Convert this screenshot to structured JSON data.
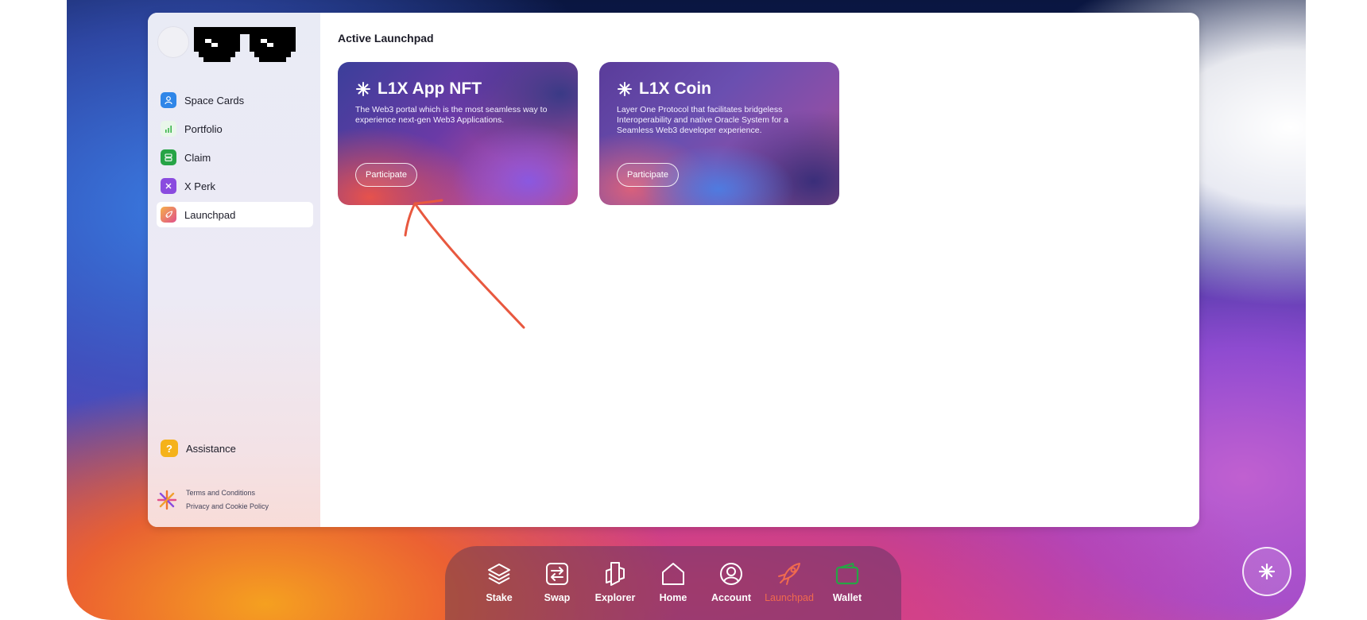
{
  "sidebar": {
    "items": [
      {
        "label": "Space Cards",
        "icon": "user-icon",
        "color": "#2f86e8"
      },
      {
        "label": "Portfolio",
        "icon": "bar-chart-icon",
        "color": "#e9f6ea"
      },
      {
        "label": "Claim",
        "icon": "claim-icon",
        "color": "#27a446"
      },
      {
        "label": "X Perk",
        "icon": "x-perk-icon",
        "color": "#8a4bdf"
      },
      {
        "label": "Launchpad",
        "icon": "rocket-icon",
        "color": "#f07a3c"
      }
    ],
    "assistance_label": "Assistance",
    "terms_label": "Terms and Conditions",
    "privacy_label": "Privacy and Cookie Policy"
  },
  "main": {
    "section_title": "Active Launchpad",
    "cards": [
      {
        "title": "L1X App NFT",
        "description": "The Web3 portal which is the most seamless way to experience next-gen Web3 Applications.",
        "button": "Participate"
      },
      {
        "title": "L1X Coin",
        "description": "Layer One Protocol that facilitates bridgeless Interoperability and native Oracle System for a Seamless Web3 developer experience.",
        "button": "Participate"
      }
    ]
  },
  "dock": {
    "items": [
      {
        "label": "Stake",
        "icon": "layers-icon"
      },
      {
        "label": "Swap",
        "icon": "swap-icon"
      },
      {
        "label": "Explorer",
        "icon": "explorer-icon"
      },
      {
        "label": "Home",
        "icon": "home-icon"
      },
      {
        "label": "Account",
        "icon": "account-icon"
      },
      {
        "label": "Launchpad",
        "icon": "rocket-icon",
        "active": true
      },
      {
        "label": "Wallet",
        "icon": "wallet-icon"
      }
    ]
  },
  "colors": {
    "accent": "#f06a4e",
    "arrow": "#e8583f"
  }
}
